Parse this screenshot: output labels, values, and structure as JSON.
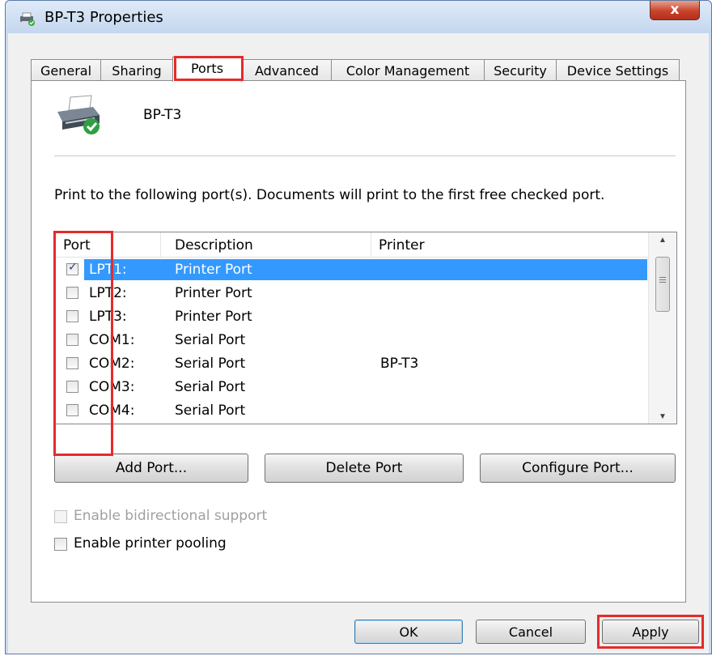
{
  "window": {
    "title": "BP-T3 Properties",
    "close_label": "x"
  },
  "tabs": [
    {
      "label": "General"
    },
    {
      "label": "Sharing"
    },
    {
      "label": "Ports",
      "active": true
    },
    {
      "label": "Advanced"
    },
    {
      "label": "Color Management"
    },
    {
      "label": "Security"
    },
    {
      "label": "Device Settings"
    }
  ],
  "printer": {
    "name": "BP-T3",
    "icon": "printer-ready-icon"
  },
  "instructions": "Print to the following port(s). Documents will print to the first free checked port.",
  "ports": {
    "columns": [
      "Port",
      "Description",
      "Printer"
    ],
    "rows": [
      {
        "port": "LPT1:",
        "description": "Printer Port",
        "printer": "",
        "checked": true,
        "selected": true
      },
      {
        "port": "LPT2:",
        "description": "Printer Port",
        "printer": "",
        "checked": false,
        "selected": false
      },
      {
        "port": "LPT3:",
        "description": "Printer Port",
        "printer": "",
        "checked": false,
        "selected": false
      },
      {
        "port": "COM1:",
        "description": "Serial Port",
        "printer": "",
        "checked": false,
        "selected": false
      },
      {
        "port": "COM2:",
        "description": "Serial Port",
        "printer": "BP-T3",
        "checked": false,
        "selected": false
      },
      {
        "port": "COM3:",
        "description": "Serial Port",
        "printer": "",
        "checked": false,
        "selected": false
      },
      {
        "port": "COM4:",
        "description": "Serial Port",
        "printer": "",
        "checked": false,
        "selected": false
      }
    ]
  },
  "port_buttons": {
    "add": "Add Port...",
    "delete": "Delete Port",
    "configure": "Configure Port..."
  },
  "options": {
    "bidirectional": {
      "label": "Enable bidirectional support",
      "checked": false,
      "disabled": true
    },
    "pooling": {
      "label": "Enable printer pooling",
      "checked": false,
      "disabled": false
    }
  },
  "dialog_buttons": {
    "ok": "OK",
    "cancel": "Cancel",
    "apply": "Apply"
  },
  "colors": {
    "selection": "#3399ff",
    "highlight": "#e52b2b",
    "close_button": "#c7432b"
  }
}
